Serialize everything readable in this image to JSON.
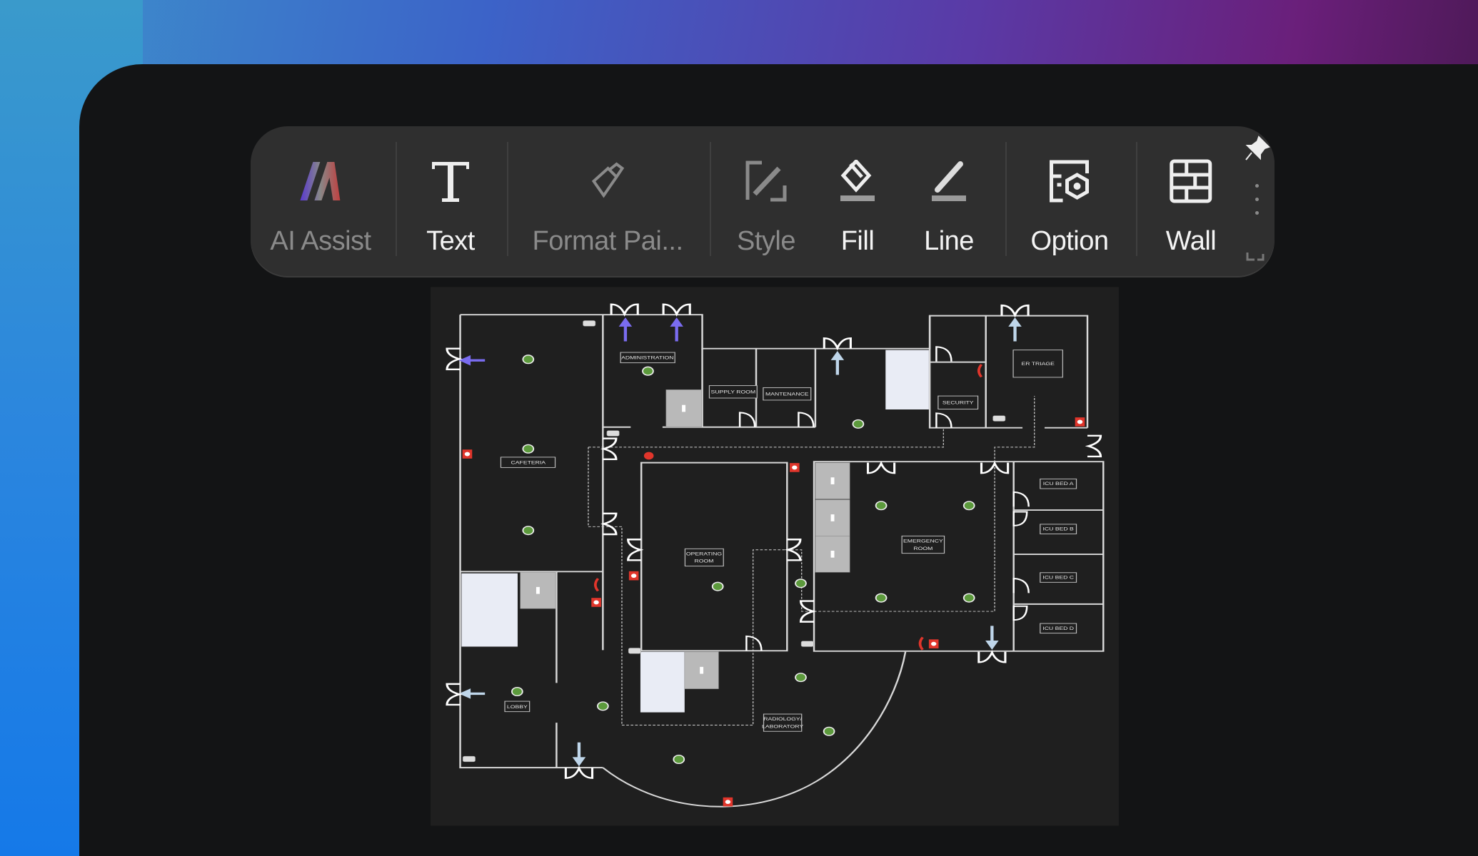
{
  "toolbar": {
    "items": [
      {
        "label": "AI Assist",
        "icon": "ai-assist-icon",
        "enabled": false
      },
      {
        "label": "Text",
        "icon": "text-icon",
        "enabled": true
      },
      {
        "label": "Format Pai...",
        "icon": "format-painter-icon",
        "enabled": false
      },
      {
        "label": "Style",
        "icon": "style-icon",
        "enabled": false
      },
      {
        "label": "Fill",
        "icon": "fill-bucket-icon",
        "enabled": true
      },
      {
        "label": "Line",
        "icon": "line-pen-icon",
        "enabled": true
      },
      {
        "label": "Option",
        "icon": "option-gear-icon",
        "enabled": true
      },
      {
        "label": "Wall",
        "icon": "wall-icon",
        "enabled": true
      }
    ],
    "pin_icon": "pin-icon",
    "more_icon": "more-vertical-icon"
  },
  "floor_plan": {
    "rooms": {
      "administration": "ADMINISTRATION",
      "supply_room": "SUPPLY ROOM",
      "maintenance": "MANTENANCE",
      "security": "SECURITY",
      "er_triage": "ER TRIAGE",
      "cafeteria": "CAFETERIA",
      "operating_room_1": "OPERATING",
      "operating_room_2": "ROOM",
      "emergency_room_1": "EMERGENCY",
      "emergency_room_2": "ROOM",
      "icu_a": "ICU BED A",
      "icu_b": "ICU BED B",
      "icu_c": "ICU BED C",
      "icu_d": "ICU BED D",
      "lobby": "LOBBY",
      "radiology_1": "RADIOLOGY/",
      "radiology_2": "LABORATORY"
    },
    "colors": {
      "canvas": "#1f1f1f",
      "wall": "#d8d8d8",
      "green_marker": "#5c9a3c",
      "fire": "#e0352b",
      "exit_arrow": "#7a6cf0",
      "stairs": "#e9ecf5",
      "elevator": "#b9b9b9"
    }
  }
}
